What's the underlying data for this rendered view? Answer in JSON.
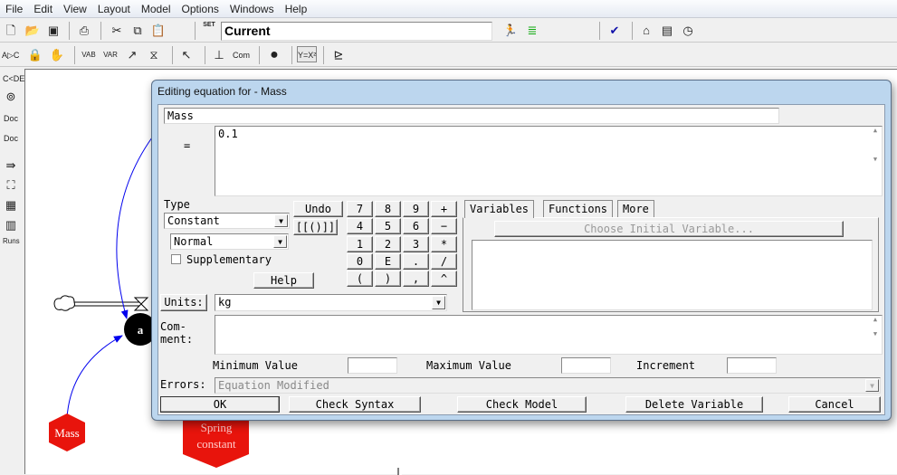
{
  "menu": [
    "File",
    "Edit",
    "View",
    "Layout",
    "Model",
    "Options",
    "Windows",
    "Help"
  ],
  "toolbar": {
    "run_name": "Current",
    "set_label": "SET"
  },
  "left_toolbar": {
    "runs_label": "Runs",
    "doc_label": "Doc"
  },
  "diagram": {
    "aux_label": "a",
    "mass_label": "Mass",
    "spring_label": "Spring constant",
    "colors": {
      "shadow_var": "#e8140c",
      "link": "#0000ee",
      "aux": "#000000"
    }
  },
  "dialog": {
    "title": "Editing equation for - Mass",
    "variable_name": "Mass",
    "equals": "=",
    "equation": "0.1",
    "type_label": "Type",
    "type_value": "Constant",
    "subtype_value": "Normal",
    "supplementary_label": "Supplementary",
    "supplementary_checked": false,
    "undo": "Undo",
    "brackets": "[[()]]",
    "help": "Help",
    "keypad": [
      "7",
      "8",
      "9",
      "+",
      "4",
      "5",
      "6",
      "−",
      "1",
      "2",
      "3",
      "*",
      "0",
      "E",
      ".",
      "/",
      "(",
      ")",
      ",",
      "^"
    ],
    "tabs": [
      "Variables",
      "Functions",
      "More"
    ],
    "active_tab": "Variables",
    "choose_initial": "Choose Initial Variable...",
    "units_label": "Units:",
    "units_value": "kg",
    "comment_label": "Com-\nment:",
    "min_label": "Minimum Value",
    "max_label": "Maximum Value",
    "increment_label": "Increment",
    "min_value": "",
    "max_value": "",
    "increment_value": "",
    "errors_label": "Errors:",
    "errors_value": "Equation Modified",
    "buttons": {
      "ok": "OK",
      "check_syntax": "Check Syntax",
      "check_model": "Check Model",
      "delete_variable": "Delete Variable",
      "cancel": "Cancel"
    }
  }
}
